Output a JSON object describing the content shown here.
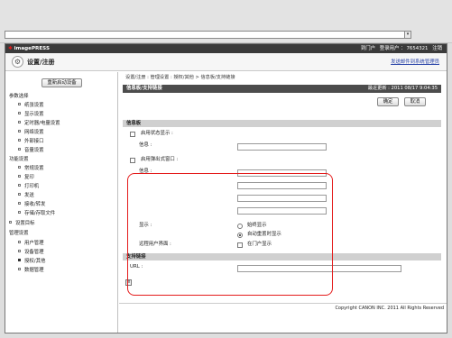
{
  "address": {
    "value": ""
  },
  "header": {
    "logo": "imagePRESS",
    "portal_link": "到门户",
    "login_user_label": "登录用户 ：",
    "login_user": "7654321",
    "logout": "注销"
  },
  "subheader": {
    "title": "设置/注册",
    "mail_link": "发送邮件到系统管理员"
  },
  "sidebar": {
    "reboot_button": "重新启动设备",
    "sections": [
      {
        "label": "参数选择",
        "items": [
          "纸张设置",
          "显示设置",
          "定时器/电量设置",
          "网络设置",
          "外部接口",
          "音量设置"
        ]
      },
      {
        "label": "功能设置",
        "items": [
          "常规设置",
          "复印",
          "打印机",
          "发送",
          "接收/转发",
          "存储/存取文件"
        ]
      },
      {
        "label": "设置目标",
        "items": []
      },
      {
        "label": "管理设置",
        "items": [
          "用户管理",
          "设备管理",
          "授权/其他",
          "数据管理"
        ]
      }
    ],
    "active_item": "授权/其他"
  },
  "main": {
    "breadcrumb": "设置/注册 : 管理设置 : 授权/其他 > 信息板/支持链接",
    "title": "信息板/支持链接",
    "last_updated": "最近更新 : 2011 08/17 9:04:35",
    "ok_button": "确定",
    "cancel_button": "取消",
    "info_board": {
      "section_title": "信息板",
      "status_check_label": "启用状态显示 :",
      "status_message_label": "信息 :",
      "popup_check_label": "启用弹出式窗口 :",
      "popup_message_label": "信息 :",
      "display_label": "显示 :",
      "display_options": [
        "始终显示",
        "自动重置时显示"
      ],
      "display_selected": "自动重置时显示",
      "remote_ui_label": "远程用户界面 :",
      "remote_ui_option": "在门户显示"
    },
    "support_link": {
      "section_title": "支持链接",
      "url_label": "URL :",
      "url_value": ""
    }
  },
  "footer": "Copyright CANON INC. 2011 All Rights Reserved"
}
